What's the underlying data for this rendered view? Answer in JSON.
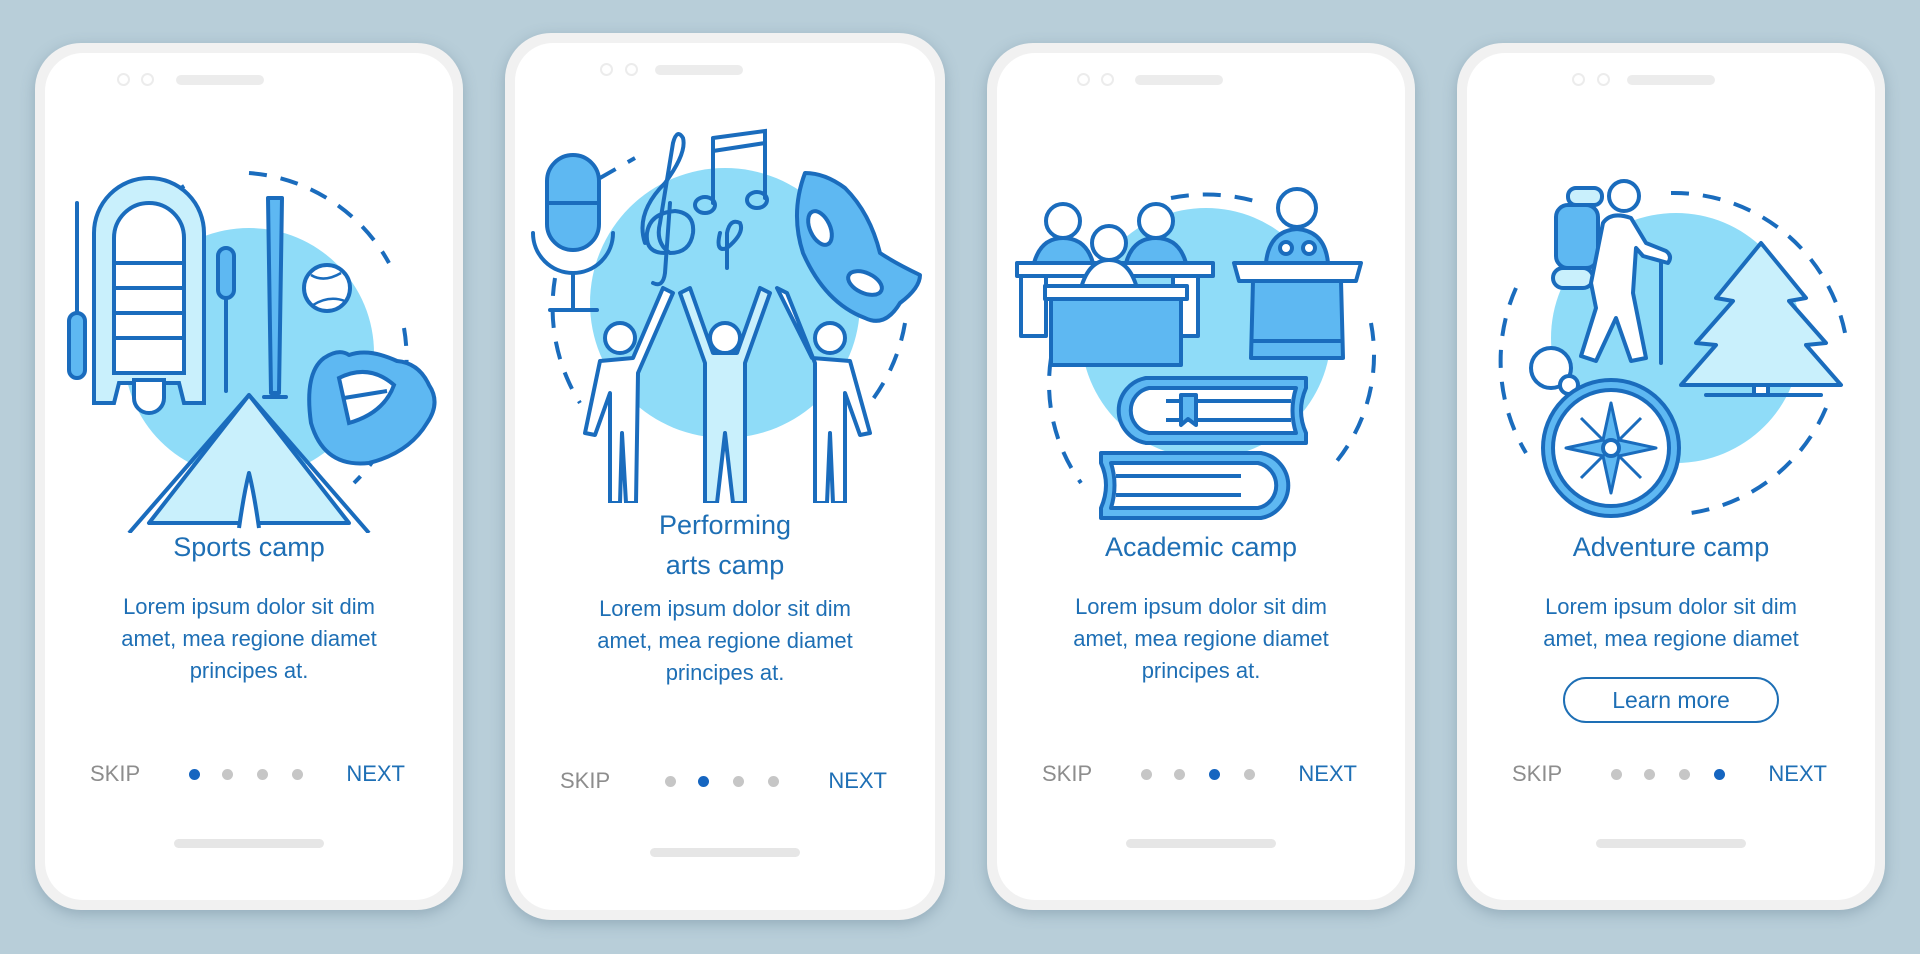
{
  "colors": {
    "background": "#b8ced9",
    "text_blue": "#1e6fb5",
    "dot_active": "#1565c0",
    "dot_inactive": "#c6c6c6",
    "skip_gray": "#8d8d8d",
    "illustration_stroke": "#1a6cbd",
    "illustration_light": "#8fdcf8",
    "illustration_mid": "#5eb8f2",
    "illustration_pale": "#c9f0fc"
  },
  "screens": [
    {
      "title": "Sports camp",
      "title_lines": [
        "Sports camp"
      ],
      "body_lines": [
        "Lorem ipsum dolor sit dim",
        "amet, mea regione diamet",
        "principes at."
      ],
      "skip_label": "SKIP",
      "next_label": "NEXT",
      "page_index": 1,
      "page_count": 4,
      "illustration": [
        "inflatable-boat-icon",
        "paddle-icon",
        "baseball-bat-icon",
        "baseball-icon",
        "baseball-glove-icon",
        "tent-icon"
      ]
    },
    {
      "title": "Performing arts camp",
      "title_lines": [
        "Performing",
        "arts camp"
      ],
      "body_lines": [
        "Lorem ipsum dolor sit dim",
        "amet, mea regione diamet",
        "principes at."
      ],
      "skip_label": "SKIP",
      "next_label": "NEXT",
      "page_index": 2,
      "page_count": 4,
      "illustration": [
        "microphone-icon",
        "treble-clef-icon",
        "music-notes-icon",
        "theater-mask-icon",
        "people-cheering-icon"
      ]
    },
    {
      "title": "Academic camp",
      "title_lines": [
        "Academic camp"
      ],
      "body_lines": [
        "Lorem ipsum dolor sit dim",
        "amet, mea regione diamet",
        "principes at."
      ],
      "skip_label": "SKIP",
      "next_label": "NEXT",
      "page_index": 3,
      "page_count": 4,
      "illustration": [
        "students-at-desks-icon",
        "speaker-at-podium-icon",
        "stacked-books-icon"
      ]
    },
    {
      "title": "Adventure camp",
      "title_lines": [
        "Adventure camp"
      ],
      "body_lines": [
        "Lorem ipsum dolor sit dim",
        "amet, mea regione diamet"
      ],
      "button_label": "Learn more",
      "skip_label": "SKIP",
      "next_label": "NEXT",
      "page_index": 4,
      "page_count": 4,
      "illustration": [
        "hiker-with-backpack-icon",
        "pine-tree-icon",
        "compass-icon"
      ]
    }
  ]
}
